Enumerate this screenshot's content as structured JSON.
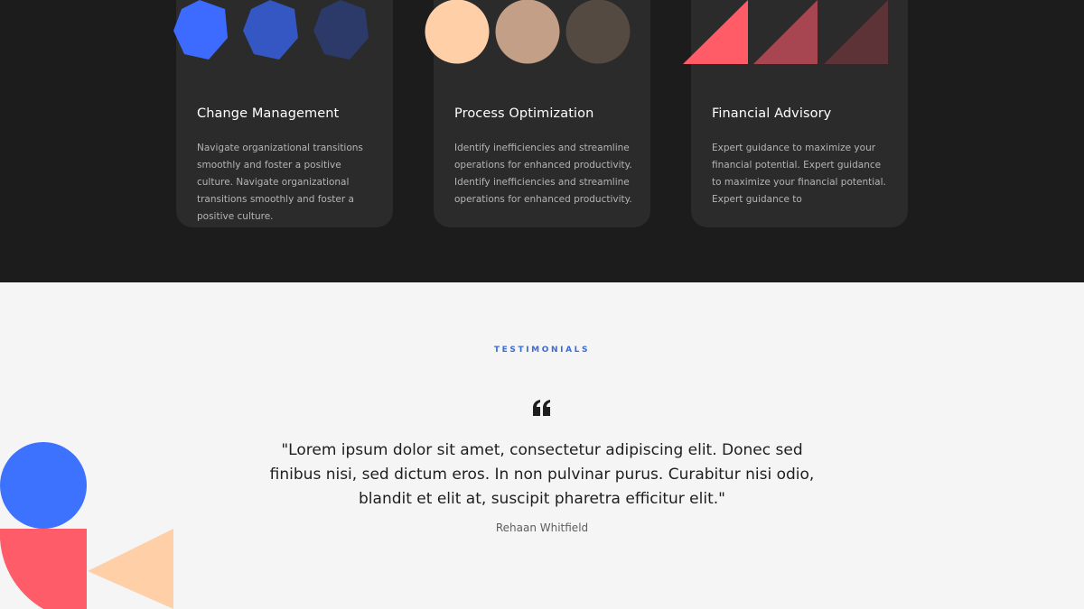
{
  "services": {
    "cards": [
      {
        "title": "Change Management",
        "description": "Navigate organizational transitions smoothly and foster a positive culture. Navigate organizational transitions smoothly and foster a positive culture.",
        "shape_icon": "hexagon-icons",
        "shape_colors": [
          "#3d6bff",
          "#3457c4",
          "#2c3a6a"
        ]
      },
      {
        "title": "Process Optimization",
        "description": "Identify inefficiencies and streamline operations for enhanced productivity. Identify inefficiencies and streamline operations for enhanced productivity.",
        "shape_icon": "circle-icons",
        "shape_colors": [
          "#ffcfa8",
          "#c29f86",
          "#544a42"
        ]
      },
      {
        "title": "Financial Advisory",
        "description": "Expert guidance to maximize your financial potential. Expert guidance to maximize your financial potential. Expert guidance to",
        "shape_icon": "triangle-icons",
        "shape_colors": [
          "#ff5c68",
          "#a74650",
          "#5d3338"
        ]
      }
    ]
  },
  "testimonials": {
    "eyebrow": "TESTIMONIALS",
    "quote": "\"Lorem ipsum dolor sit amet, consectetur adipiscing elit. Donec sed finibus nisi, sed dictum eros. In non pulvinar purus. Curabitur nisi odio, blandit et elit at, suscipit pharetra efficitur elit.\"",
    "author": "Rehaan Whitfield",
    "quote_icon": "quote-icon"
  },
  "colors": {
    "dark_bg": "#1c1c1c",
    "card_bg": "#2b2b2b",
    "light_bg": "#f5f5f5",
    "accent_blue": "#3b6bd6",
    "decor_blue": "#3d72ff",
    "decor_red": "#ff5c6a",
    "decor_peach": "#ffd0a8"
  }
}
